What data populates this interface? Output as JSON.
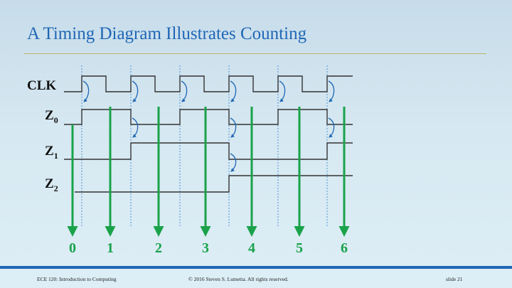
{
  "slide": {
    "title": "A Timing Diagram Illustrates Counting",
    "footer_left": "ECE 120: Introduction to Computing",
    "footer_center": "© 2016 Steven S. Lumetta.  All rights reserved.",
    "footer_right": "slide 21"
  },
  "signals": [
    {
      "name": "CLK",
      "subscript": ""
    },
    {
      "name": "Z",
      "subscript": "0"
    },
    {
      "name": "Z",
      "subscript": "1"
    },
    {
      "name": "Z",
      "subscript": "2"
    }
  ],
  "count_labels": [
    "0",
    "1",
    "2",
    "3",
    "4",
    "5",
    "6"
  ],
  "colors": {
    "title": "#1f66b5",
    "waveform": "#333333",
    "edge_marker": "#1f66b5",
    "count_arrow": "#1aa24a"
  }
}
